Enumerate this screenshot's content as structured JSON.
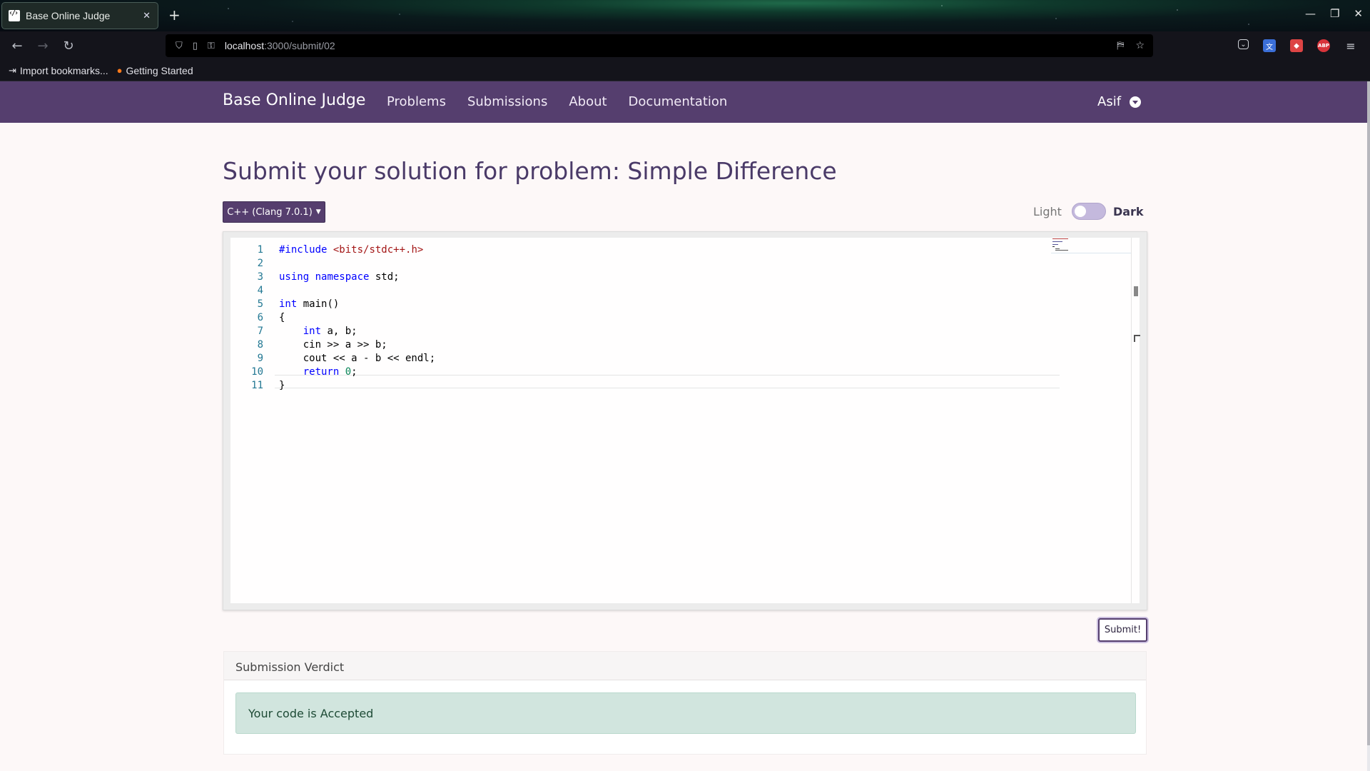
{
  "browser": {
    "tab_title": "Base Online Judge",
    "url_host": "localhost",
    "url_path": ":3000/submit/02",
    "bookmarks": [
      "Import bookmarks...",
      "Getting Started"
    ],
    "extensions": [
      "pocket-icon",
      "translate-icon",
      "extension-icon",
      "adblock-icon",
      "menu-icon"
    ],
    "abp_label": "ABP"
  },
  "nav": {
    "brand": "Base Online Judge",
    "links": [
      "Problems",
      "Submissions",
      "About",
      "Documentation"
    ],
    "user": "Asif"
  },
  "main": {
    "title": "Submit your solution for problem: Simple Difference",
    "language": "C++ (Clang 7.0.1)",
    "theme_light": "Light",
    "theme_dark": "Dark",
    "theme_is_dark": false,
    "submit_label": "Submit!"
  },
  "editor": {
    "line_numbers": [
      "1",
      "2",
      "3",
      "4",
      "5",
      "6",
      "7",
      "8",
      "9",
      "10",
      "11"
    ],
    "lines": [
      "#include <bits/stdc++.h>",
      "",
      "using namespace std;",
      "",
      "int main()",
      "{",
      "    int a, b;",
      "    cin >> a >> b;",
      "    cout << a - b << endl;",
      "    return 0;",
      "}"
    ]
  },
  "verdict": {
    "header": "Submission Verdict",
    "message": "Your code is Accepted"
  },
  "colors": {
    "brand_purple": "#553e6e",
    "accepted_bg": "#d1e5de"
  }
}
